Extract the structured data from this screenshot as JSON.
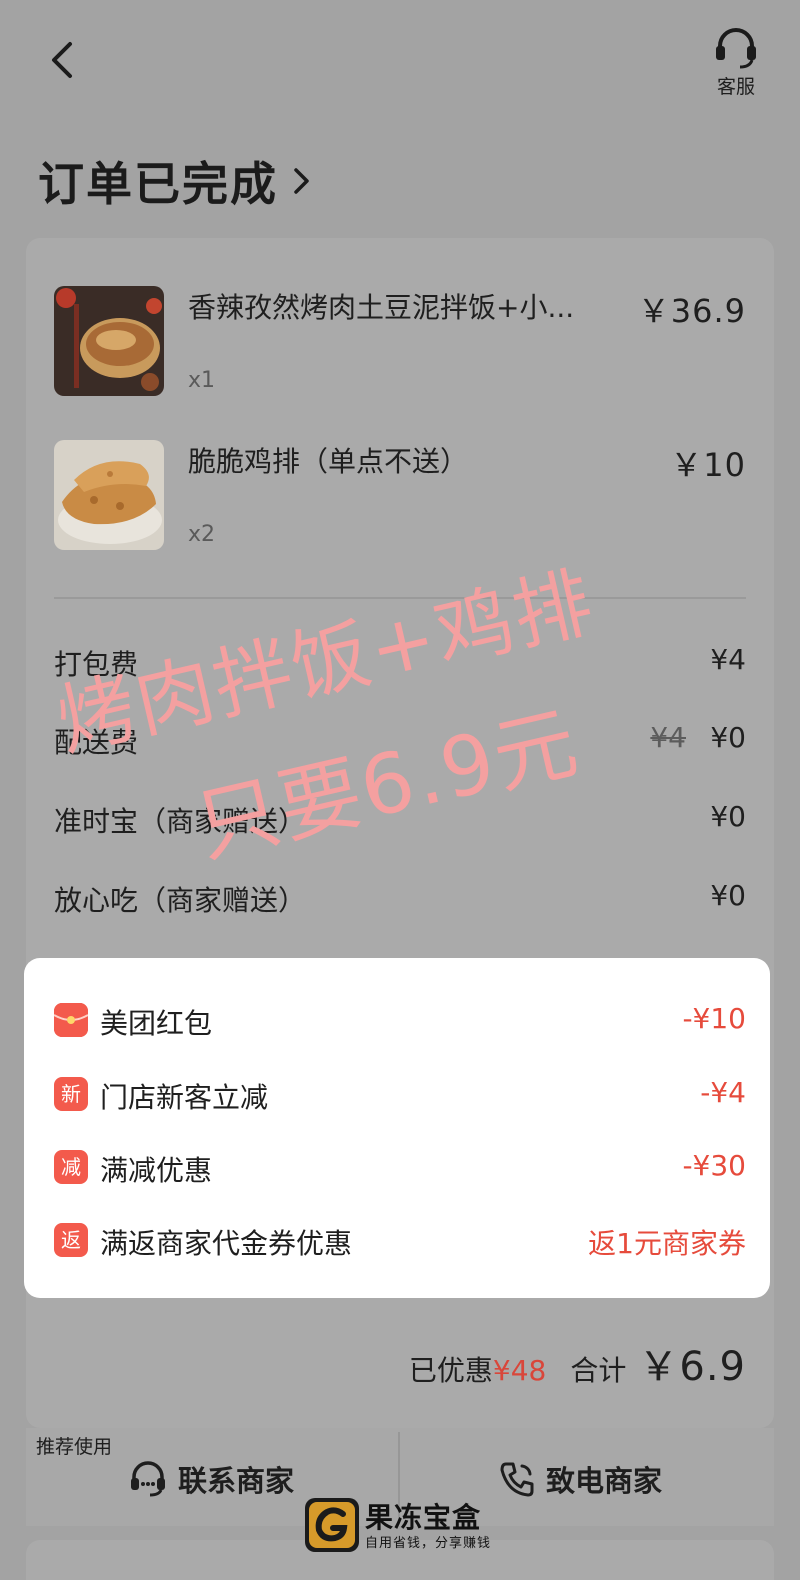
{
  "header": {
    "customer_service_label": "客服",
    "title": "订单已完成"
  },
  "items": [
    {
      "name": "香辣孜然烤肉土豆泥拌饭+小...",
      "qty": "x1",
      "price": "￥36.9"
    },
    {
      "name": "脆脆鸡排（单点不送）",
      "qty": "x2",
      "price": "￥10"
    }
  ],
  "fees": [
    {
      "label": "打包费",
      "value": "¥4"
    },
    {
      "label": "配送费",
      "original": "¥4",
      "value": "¥0"
    },
    {
      "label": "准时宝（商家赠送）",
      "value": "¥0"
    },
    {
      "label": "放心吃（商家赠送）",
      "value": "¥0"
    }
  ],
  "promos": [
    {
      "icon": "red-packet-icon",
      "badge": "",
      "label": "美团红包",
      "value": "-¥10"
    },
    {
      "icon": "new-customer-icon",
      "badge": "新",
      "label": "门店新客立减",
      "value": "-¥4"
    },
    {
      "icon": "discount-icon",
      "badge": "减",
      "label": "满减优惠",
      "value": "-¥30"
    },
    {
      "icon": "rebate-icon",
      "badge": "返",
      "label": "满返商家代金券优惠",
      "value": "返1元商家券"
    }
  ],
  "summary": {
    "saved_label": "已优惠",
    "saved_value": "¥48",
    "total_label": "合计",
    "total_value": "￥6.9"
  },
  "actions": {
    "recommend_label": "推荐使用",
    "contact_label": "联系商家",
    "call_label": "致电商家"
  },
  "overlay_text": {
    "line1": "烤肉拌饭+鸡排",
    "line2": "只要6.9元"
  },
  "watermark": {
    "name": "果冻宝盒",
    "slogan": "自用省钱，分享赚钱"
  },
  "colors": {
    "accent_red": "#e64b3c",
    "overlay_pink": "#f4a0a0"
  }
}
